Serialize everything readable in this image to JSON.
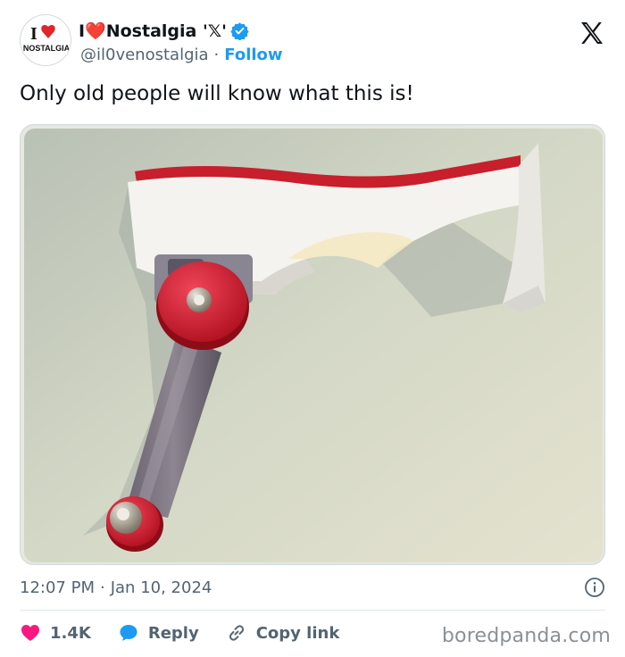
{
  "author": {
    "display_name": "I❤️Nostalgia '𝕏'",
    "handle": "@il0venostalgia",
    "separator": "·",
    "follow_label": "Follow",
    "avatar_line1": "I",
    "avatar_line2": "NOSTALGIA"
  },
  "tweet": {
    "text": "Only old people will know what this is!",
    "time": "12:07 PM",
    "separator": "·",
    "date": "Jan 10, 2024"
  },
  "actions": {
    "like_count": "1.4K",
    "reply_label": "Reply",
    "copy_label": "Copy link"
  },
  "watermark": "boredpanda.com",
  "colors": {
    "accent": "#1d9bf0",
    "like": "#f91880",
    "text": "#0f1419",
    "secondary": "#536471"
  }
}
